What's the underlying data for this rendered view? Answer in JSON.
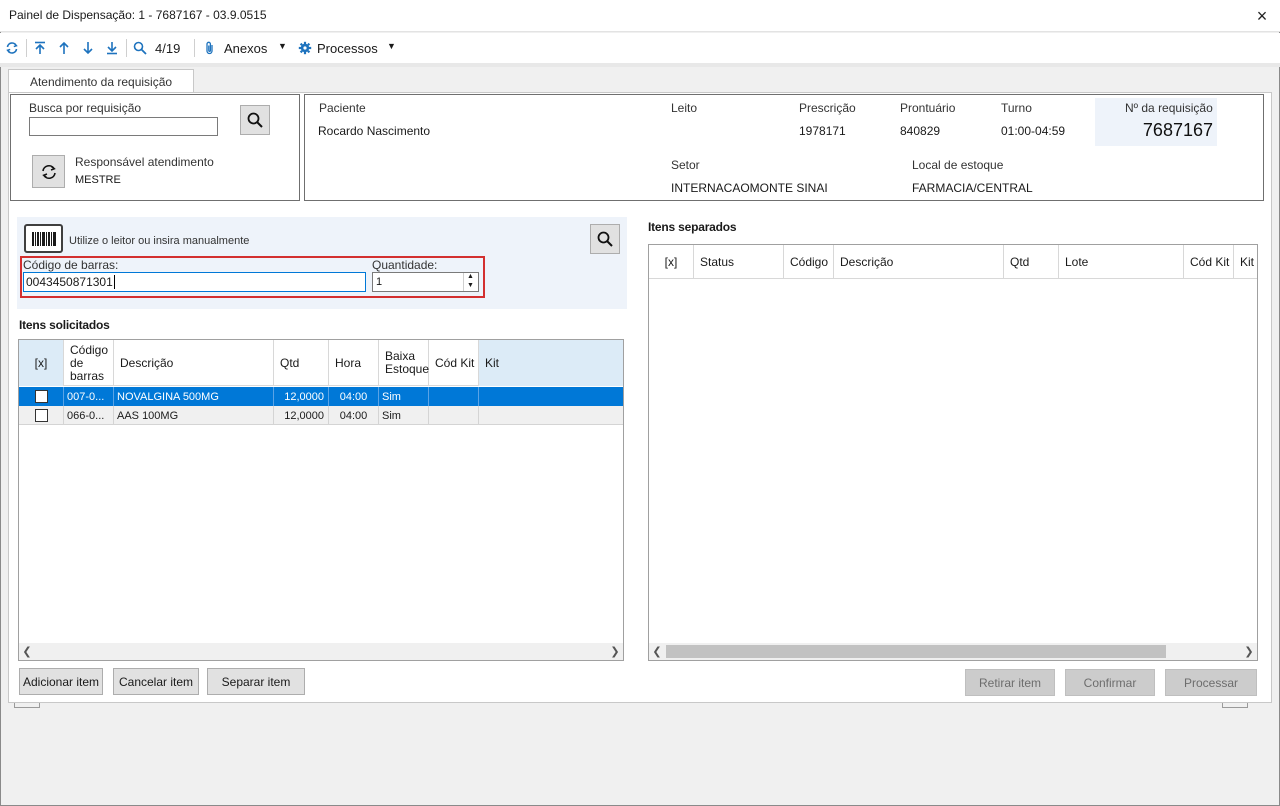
{
  "window": {
    "title": "Painel de Dispensação: 1 - 7687167 - 03.9.0515",
    "close_icon": "×"
  },
  "toolbar": {
    "counter": "4/19",
    "anexos_label": "Anexos",
    "processos_label": "Processos"
  },
  "tabs": [
    {
      "label": "Atendimento da requisição"
    }
  ],
  "search_box": {
    "label": "Busca por requisição",
    "value": "",
    "responsavel_label": "Responsável atendimento",
    "responsavel_value": "MESTRE"
  },
  "patient": {
    "paciente_label": "Paciente",
    "paciente_value": "Rocardo Nascimento",
    "leito_label": "Leito",
    "leito_value": "",
    "prescricao_label": "Prescrição",
    "prescricao_value": "1978171",
    "prontuario_label": "Prontuário",
    "prontuario_value": "840829",
    "turno_label": "Turno",
    "turno_value": "01:00-04:59",
    "requisicao_label": "Nº da requisição",
    "requisicao_value": "7687167",
    "setor_label": "Setor",
    "setor_value": "INTERNACAOMONTE SINAI",
    "local_label": "Local de estoque",
    "local_value": "FARMACIA/CENTRAL"
  },
  "scan": {
    "hint": "Utilize o leitor ou insira manualmente",
    "barcode_label": "Código de barras:",
    "barcode_value": "0043450871301",
    "qty_label": "Quantidade:",
    "qty_value": "1"
  },
  "solicitados": {
    "title": "Itens solicitados",
    "headers": [
      "[x]",
      "Código de barras",
      "Descrição",
      "Qtd",
      "Hora",
      "Baixa Estoque",
      "Cód Kit",
      "Kit"
    ],
    "rows": [
      {
        "codigo": "007-0...",
        "descricao": "NOVALGINA 500MG",
        "qtd": "12,0000",
        "hora": "04:00",
        "baixa": "Sim",
        "cod_kit": "",
        "kit": "",
        "selected": true
      },
      {
        "codigo": "066-0...",
        "descricao": "AAS 100MG",
        "qtd": "12,0000",
        "hora": "04:00",
        "baixa": "Sim",
        "cod_kit": "",
        "kit": "",
        "selected": false
      }
    ]
  },
  "separados": {
    "title": "Itens separados",
    "headers": [
      "[x]",
      "Status",
      "Código",
      "Descrição",
      "Qtd",
      "Lote",
      "Cód Kit",
      "Kit"
    ]
  },
  "buttons": {
    "adicionar": "Adicionar item",
    "cancelar": "Cancelar item",
    "separar": "Separar item",
    "retirar": "Retirar item",
    "confirmar": "Confirmar",
    "processar": "Processar"
  },
  "colors": {
    "selection": "#0078d7",
    "highlight_bg": "#eef3fa",
    "focus_border": "#d32f2f"
  }
}
